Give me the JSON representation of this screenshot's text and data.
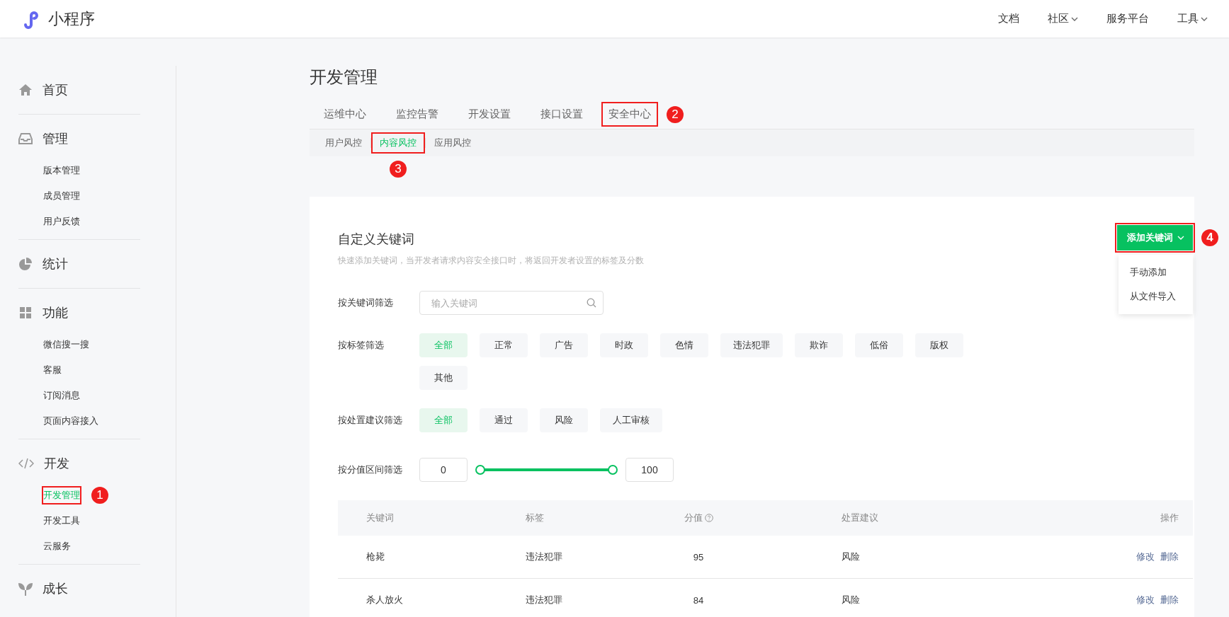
{
  "header": {
    "brand": "小程序",
    "nav": [
      {
        "label": "文档",
        "dropdown": false
      },
      {
        "label": "社区",
        "dropdown": true
      },
      {
        "label": "服务平台",
        "dropdown": false
      },
      {
        "label": "工具",
        "dropdown": true
      }
    ]
  },
  "sidebar": [
    {
      "title": "首页"
    },
    {
      "title": "管理",
      "items": [
        {
          "label": "版本管理",
          "selected": false
        },
        {
          "label": "成员管理",
          "selected": false
        },
        {
          "label": "用户反馈",
          "selected": false
        }
      ]
    },
    {
      "title": "统计"
    },
    {
      "title": "功能",
      "items": [
        {
          "label": "微信搜一搜",
          "selected": false
        },
        {
          "label": "客服",
          "selected": false
        },
        {
          "label": "订阅消息",
          "selected": false
        },
        {
          "label": "页面内容接入",
          "selected": false
        }
      ]
    },
    {
      "title": "开发",
      "items": [
        {
          "label": "开发管理",
          "selected": true,
          "callout": "1"
        },
        {
          "label": "开发工具",
          "selected": false
        },
        {
          "label": "云服务",
          "selected": false
        }
      ]
    },
    {
      "title": "成长"
    }
  ],
  "page_title": "开发管理",
  "tabs": [
    {
      "label": "运维中心"
    },
    {
      "label": "监控告警"
    },
    {
      "label": "开发设置"
    },
    {
      "label": "接口设置"
    },
    {
      "label": "安全中心",
      "callout": "2"
    }
  ],
  "subtabs": [
    {
      "label": "用户风控",
      "selected": false
    },
    {
      "label": "内容风控",
      "selected": true,
      "callout": "3"
    },
    {
      "label": "应用风控",
      "selected": false
    }
  ],
  "card": {
    "title": "自定义关键词",
    "description": "快速添加关键词，当开发者请求内容安全接口时，将返回开发者设置的标签及分数",
    "add_button": {
      "label": "添加关键词",
      "callout": "4",
      "menu": [
        "手动添加",
        "从文件导入"
      ]
    },
    "keyword_filter": {
      "label": "按关键词筛选",
      "placeholder": "输入关键词"
    },
    "tag_filter": {
      "label": "按标签筛选",
      "options": [
        {
          "label": "全部",
          "selected": true
        },
        {
          "label": "正常",
          "selected": false
        },
        {
          "label": "广告",
          "selected": false
        },
        {
          "label": "时政",
          "selected": false
        },
        {
          "label": "色情",
          "selected": false
        },
        {
          "label": "违法犯罪",
          "selected": false
        },
        {
          "label": "欺诈",
          "selected": false
        },
        {
          "label": "低俗",
          "selected": false
        },
        {
          "label": "版权",
          "selected": false
        },
        {
          "label": "其他",
          "selected": false
        }
      ]
    },
    "action_filter": {
      "label": "按处置建议筛选",
      "options": [
        {
          "label": "全部",
          "selected": true
        },
        {
          "label": "通过",
          "selected": false
        },
        {
          "label": "风险",
          "selected": false
        },
        {
          "label": "人工审核",
          "selected": false
        }
      ]
    },
    "score_filter": {
      "label": "按分值区间筛选",
      "min": "0",
      "max": "100",
      "thumbs": [
        {
          "level": 0
        },
        {
          "level": 1
        }
      ]
    },
    "table": {
      "columns": [
        {
          "label": "关键词",
          "help_icon": false
        },
        {
          "label": "标签",
          "help_icon": false
        },
        {
          "label": "分值",
          "help_icon": true
        },
        {
          "label": "处置建议",
          "help_icon": false
        },
        {
          "label": "操作",
          "help_icon": false
        }
      ],
      "rows": [
        {
          "keyword": "枪毙",
          "tag": "违法犯罪",
          "score": "95",
          "action": "风险",
          "operations": [
            "修改",
            "删除"
          ]
        },
        {
          "keyword": "杀人放火",
          "tag": "违法犯罪",
          "score": "84",
          "action": "风险",
          "operations": [
            "修改",
            "删除"
          ]
        }
      ]
    }
  }
}
